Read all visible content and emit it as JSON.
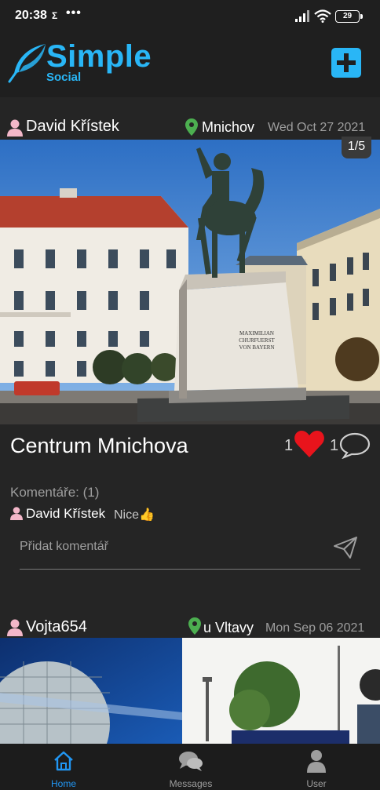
{
  "status_bar": {
    "time": "20:38",
    "sigma": "Σ",
    "dots": "•••",
    "battery": "29"
  },
  "app_bar": {
    "title": "Simple",
    "subtitle": "Social",
    "add_icon": "plus-square-icon"
  },
  "posts": [
    {
      "author": "David Křístek",
      "location": "Mnichov",
      "date": "Wed Oct 27 2021",
      "photo_counter": "1/5",
      "title": "Centrum Mnichova",
      "likes": "1",
      "comments_count": "1",
      "comments_label": "Komentáře: (1)",
      "comments": [
        {
          "author": "David Křístek",
          "text": "Nice👍"
        }
      ],
      "comment_placeholder": "Přidat komentář"
    },
    {
      "author": "Vojta654",
      "location": "u Vltavy",
      "date": "Mon Sep 06 2021"
    }
  ],
  "bottom_nav": [
    {
      "label": "Home",
      "icon": "home-icon",
      "active": true
    },
    {
      "label": "Messages",
      "icon": "chat-bubbles-icon",
      "active": false
    },
    {
      "label": "User",
      "icon": "user-icon",
      "active": false
    }
  ],
  "colors": {
    "accent": "#29b6f6",
    "like": "#e8141c",
    "location_pin": "#4caf50",
    "user_icon": "#f3b7c9",
    "background": "#252525"
  }
}
